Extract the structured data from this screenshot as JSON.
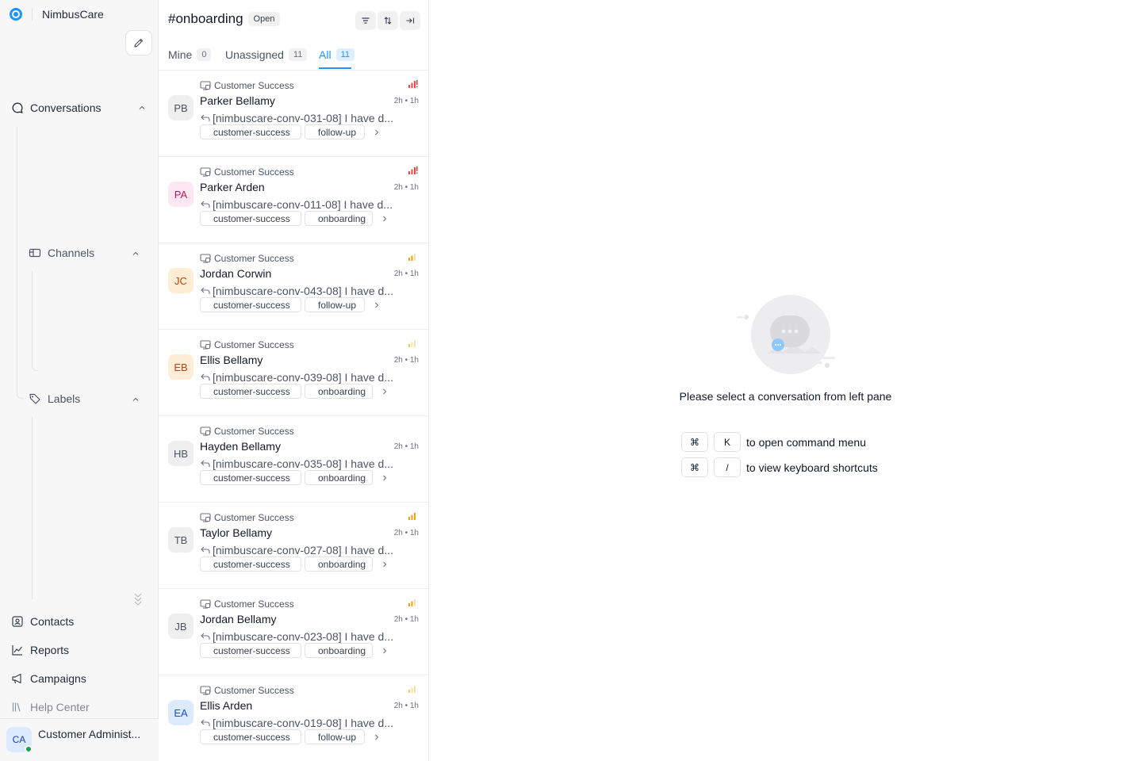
{
  "app": {
    "name": "NimbusCare"
  },
  "sidebar": {
    "conversations_label": "Conversations",
    "channels_label": "Channels",
    "labels_label": "Labels",
    "contacts_label": "Contacts",
    "reports_label": "Reports",
    "campaigns_label": "Campaigns",
    "help_center_label": "Help Center",
    "profile": {
      "initials": "CA",
      "name": "Customer Administ..."
    }
  },
  "conversation_list": {
    "title": "#onboarding",
    "status": "Open",
    "tabs": [
      {
        "label": "Mine",
        "count": "0"
      },
      {
        "label": "Unassigned",
        "count": "11"
      },
      {
        "label": "All",
        "count": "11"
      }
    ],
    "items": [
      {
        "inbox": "Customer Success",
        "initials": "PB",
        "name": "Parker Bellamy",
        "meta": "2h • 1h",
        "preview": "[nimbuscare-conv-031-08] I have d...",
        "labels": [
          "customer-success",
          "follow-up"
        ],
        "priority": "urgent"
      },
      {
        "inbox": "Customer Success",
        "initials": "PA",
        "name": "Parker Arden",
        "meta": "2h • 1h",
        "preview": "[nimbuscare-conv-011-08] I have d...",
        "labels": [
          "customer-success",
          "onboarding"
        ],
        "priority": "urgent"
      },
      {
        "inbox": "Customer Success",
        "initials": "JC",
        "name": "Jordan Corwin",
        "meta": "2h • 1h",
        "preview": "[nimbuscare-conv-043-08] I have d...",
        "labels": [
          "customer-success",
          "follow-up"
        ],
        "priority": "medium"
      },
      {
        "inbox": "Customer Success",
        "initials": "EB",
        "name": "Ellis Bellamy",
        "meta": "2h • 1h",
        "preview": "[nimbuscare-conv-039-08] I have d...",
        "labels": [
          "customer-success",
          "onboarding"
        ],
        "priority": "low"
      },
      {
        "inbox": "Customer Success",
        "initials": "HB",
        "name": "Hayden Bellamy",
        "meta": "2h • 1h",
        "preview": "[nimbuscare-conv-035-08] I have d...",
        "labels": [
          "customer-success",
          "onboarding"
        ],
        "priority": "none"
      },
      {
        "inbox": "Customer Success",
        "initials": "TB",
        "name": "Taylor Bellamy",
        "meta": "2h • 1h",
        "preview": "[nimbuscare-conv-027-08] I have d...",
        "labels": [
          "customer-success",
          "onboarding"
        ],
        "priority": "high"
      },
      {
        "inbox": "Customer Success",
        "initials": "JB",
        "name": "Jordan Bellamy",
        "meta": "2h • 1h",
        "preview": "[nimbuscare-conv-023-08] I have d...",
        "labels": [
          "customer-success",
          "onboarding"
        ],
        "priority": "medium"
      },
      {
        "inbox": "Customer Success",
        "initials": "EA",
        "name": "Ellis Arden",
        "meta": "2h • 1h",
        "preview": "[nimbuscare-conv-019-08] I have d...",
        "labels": [
          "customer-success",
          "follow-up"
        ],
        "priority": "low"
      }
    ]
  },
  "empty_state": {
    "message": "Please select a conversation from left pane",
    "shortcuts": [
      {
        "keys": [
          "⌘",
          "K"
        ],
        "description": "to open command menu"
      },
      {
        "keys": [
          "⌘",
          "/"
        ],
        "description": "to view keyboard shortcuts"
      }
    ]
  },
  "colors": {
    "accent": "#1f93ff",
    "priority_urgent": "#ef4444",
    "priority_high": "#f59e0b",
    "avatar_pb_bg": "#efefef",
    "avatar_pa_bg": "#fce7f3",
    "avatar_jc_bg": "#ffedd5",
    "avatar_eb_bg": "#ffedd5",
    "avatar_ea_bg": "#dbeafe"
  }
}
